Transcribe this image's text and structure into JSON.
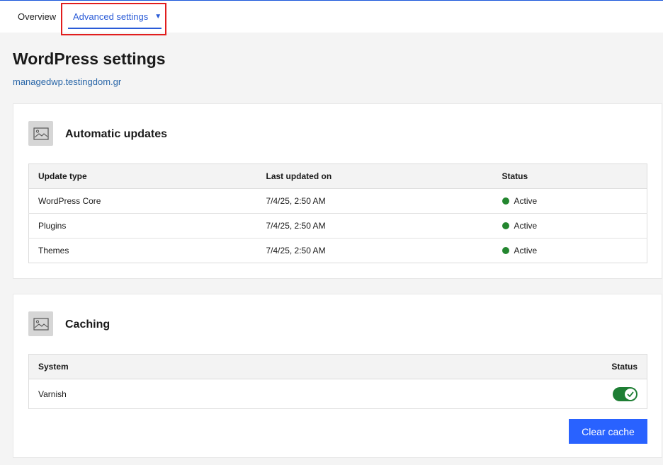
{
  "tabs": {
    "overview_label": "Overview",
    "advanced_label": "Advanced settings",
    "advanced_caret": "▼"
  },
  "page": {
    "title": "WordPress settings",
    "domain_link": "managedwp.testingdom.gr"
  },
  "updates": {
    "title": "Automatic updates",
    "icon": "image-icon",
    "headers": {
      "type": "Update type",
      "last": "Last updated on",
      "status": "Status"
    },
    "rows": [
      {
        "type": "WordPress Core",
        "last": "7/4/25, 2:50 AM",
        "status": "Active"
      },
      {
        "type": "Plugins",
        "last": "7/4/25, 2:50 AM",
        "status": "Active"
      },
      {
        "type": "Themes",
        "last": "7/4/25, 2:50 AM",
        "status": "Active"
      }
    ]
  },
  "caching": {
    "title": "Caching",
    "icon": "image-icon",
    "headers": {
      "system": "System",
      "status": "Status"
    },
    "rows": [
      {
        "system": "Varnish",
        "enabled": true
      }
    ],
    "clear_button": "Clear cache"
  },
  "colors": {
    "accent": "#2962ff",
    "link": "#2966a8",
    "status_active": "#23862f",
    "toggle_on": "#1e7e34",
    "highlight": "#e11d1d"
  }
}
